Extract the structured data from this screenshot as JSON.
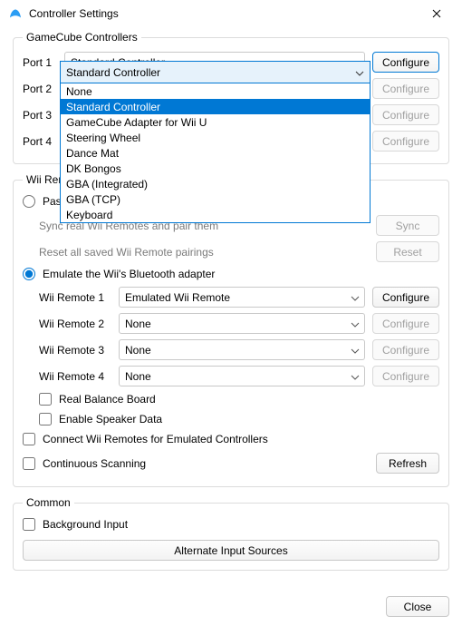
{
  "title": "Controller Settings",
  "gc": {
    "legend": "GameCube Controllers",
    "port_label": [
      "Port 1",
      "Port 2",
      "Port 3",
      "Port 4"
    ],
    "dropdown_options": [
      "None",
      "Standard Controller",
      "GameCube Adapter for Wii U",
      "Steering Wheel",
      "Dance Mat",
      "DK Bongos",
      "GBA (Integrated)",
      "GBA (TCP)",
      "Keyboard"
    ],
    "selected": "Standard Controller",
    "configure": "Configure"
  },
  "wii": {
    "legend": "Wii Remotes",
    "radio_passthrough": "Passthrough a Bluetooth adapter",
    "sync_text": "Sync real Wii Remotes and pair them",
    "sync_btn": "Sync",
    "reset_text": "Reset all saved Wii Remote pairings",
    "reset_btn": "Reset",
    "radio_emulate": "Emulate the Wii's Bluetooth adapter",
    "remote_label": [
      "Wii Remote 1",
      "Wii Remote 2",
      "Wii Remote 3",
      "Wii Remote 4"
    ],
    "remote_value": [
      "Emulated Wii Remote",
      "None",
      "None",
      "None"
    ],
    "configure": "Configure",
    "real_balance": "Real Balance Board",
    "speaker": "Enable Speaker Data",
    "connect_emu": "Connect Wii Remotes for Emulated Controllers",
    "continuous": "Continuous Scanning",
    "refresh": "Refresh"
  },
  "common": {
    "legend": "Common",
    "bg_input": "Background Input",
    "alt_sources": "Alternate Input Sources"
  },
  "close": "Close"
}
